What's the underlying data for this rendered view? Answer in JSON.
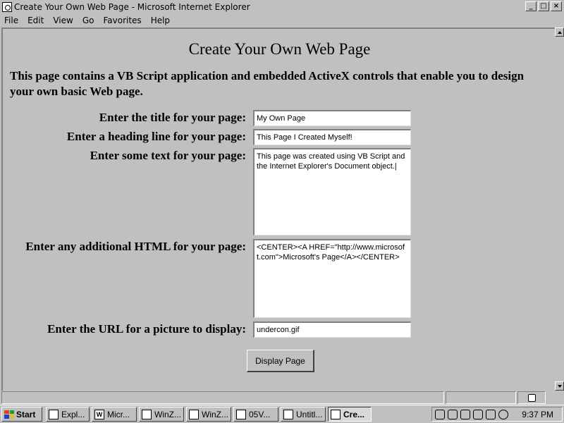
{
  "window": {
    "title": "Create Your Own Web Page - Microsoft Internet Explorer",
    "minimize": "_",
    "maximize": "□",
    "close": "×"
  },
  "menu": {
    "file": "File",
    "edit": "Edit",
    "view": "View",
    "go": "Go",
    "favorites": "Favorites",
    "help": "Help"
  },
  "page": {
    "heading": "Create Your Own Web Page",
    "intro": "This page contains a VB Script application and embedded ActiveX controls that enable you to design your own basic Web page."
  },
  "form": {
    "title_label": "Enter the title for your page:",
    "title_value": "My Own Page",
    "heading_label": "Enter a heading line for your page:",
    "heading_value": "This Page I Created Myself!",
    "text_label": "Enter some text for your page:",
    "text_value": "This page was created using VB Script and the Internet Explorer's Document object.|",
    "html_label": "Enter any additional HTML for your page:",
    "html_value": "<CENTER><A HREF=\"http://www.microsoft.com\">Microsoft's Page</A></CENTER>",
    "url_label": "Enter the URL for a picture to display:",
    "url_value": "undercon.gif",
    "display_button": "Display Page"
  },
  "taskbar": {
    "start": "Start",
    "tasks": [
      {
        "label": "Expl...",
        "icon": "explorer-icon"
      },
      {
        "label": "Micr...",
        "icon": "word-icon"
      },
      {
        "label": "WinZ...",
        "icon": "winzip-icon"
      },
      {
        "label": "WinZ...",
        "icon": "winzip-icon"
      },
      {
        "label": "05V...",
        "icon": "image-icon"
      },
      {
        "label": "Untitl...",
        "icon": "notepad-icon"
      },
      {
        "label": "Cre...",
        "icon": "ie-icon"
      }
    ],
    "clock": "9:37 PM"
  }
}
